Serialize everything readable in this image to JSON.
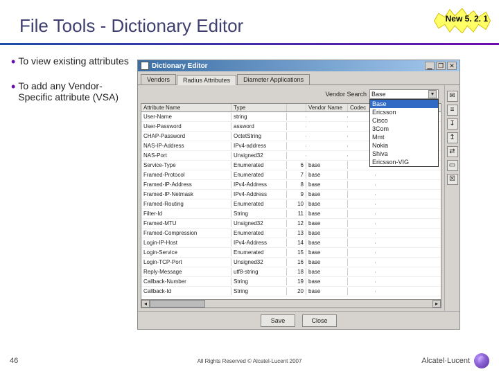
{
  "title": "File Tools - Dictionary Editor",
  "badge": "New 5. 2. 1",
  "bullets": [
    "To view existing attributes",
    "To add any Vendor-Specific attribute (VSA)"
  ],
  "window": {
    "title": "Dictionary Editor",
    "tabs": [
      "Vendors",
      "Radius Attributes",
      "Diameter Applications"
    ],
    "active_tab": 1,
    "search_label": "Vendor Search",
    "search_value": "Base",
    "dropdown_options": [
      "Base",
      "Ericsson",
      "Cisco",
      "3Com",
      "Mmt",
      "Nokia",
      "Shiva",
      "Ericsson-VIG"
    ],
    "columns": [
      "Attribute Name",
      "Type",
      "",
      "Vendor Name",
      "Codec"
    ],
    "rows": [
      {
        "name": "User-Name",
        "type": "string",
        "num": "",
        "vendor": "",
        "codec": ""
      },
      {
        "name": "User-Password",
        "type": "assword",
        "num": "",
        "vendor": "",
        "codec": ""
      },
      {
        "name": "CHAP-Password",
        "type": "OctetString",
        "num": "",
        "vendor": "",
        "codec": ""
      },
      {
        "name": "NAS-IP-Address",
        "type": "IPv4-address",
        "num": "",
        "vendor": "",
        "codec": ""
      },
      {
        "name": "NAS-Port",
        "type": "Unsigned32",
        "num": "",
        "vendor": "",
        "codec": ""
      },
      {
        "name": "Service-Type",
        "type": "Enumerated",
        "num": "6",
        "vendor": "base",
        "codec": ""
      },
      {
        "name": "Framed-Protocol",
        "type": "Enumerated",
        "num": "7",
        "vendor": "base",
        "codec": ""
      },
      {
        "name": "Framed-IP-Address",
        "type": "IPv4-Address",
        "num": "8",
        "vendor": "base",
        "codec": ""
      },
      {
        "name": "Framed-IP-Netmask",
        "type": "IPv4-Address",
        "num": "9",
        "vendor": "base",
        "codec": ""
      },
      {
        "name": "Framed-Routing",
        "type": "Enumerated",
        "num": "10",
        "vendor": "base",
        "codec": ""
      },
      {
        "name": "Filter-Id",
        "type": "String",
        "num": "11",
        "vendor": "base",
        "codec": ""
      },
      {
        "name": "Framed-MTU",
        "type": "Unsigned32",
        "num": "12",
        "vendor": "base",
        "codec": ""
      },
      {
        "name": "Framed-Compression",
        "type": "Enumerated",
        "num": "13",
        "vendor": "base",
        "codec": ""
      },
      {
        "name": "Login-IP-Host",
        "type": "IPv4-Address",
        "num": "14",
        "vendor": "base",
        "codec": ""
      },
      {
        "name": "Login-Service",
        "type": "Enumerated",
        "num": "15",
        "vendor": "base",
        "codec": ""
      },
      {
        "name": "Login-TCP-Port",
        "type": "Unsigned32",
        "num": "16",
        "vendor": "base",
        "codec": ""
      },
      {
        "name": "Reply-Message",
        "type": "utf8-string",
        "num": "18",
        "vendor": "base",
        "codec": ""
      },
      {
        "name": "Callback-Number",
        "type": "String",
        "num": "19",
        "vendor": "base",
        "codec": ""
      },
      {
        "name": "Callback-Id",
        "type": "String",
        "num": "20",
        "vendor": "base",
        "codec": ""
      }
    ],
    "buttons": {
      "save": "Save",
      "close": "Close"
    },
    "tool_icons": [
      "new-icon",
      "add-icon",
      "down-arrow-icon",
      "up-arrow-icon",
      "align-icon",
      "hide-icon",
      "delete-icon"
    ]
  },
  "footer": {
    "page": "46",
    "copyright": "All Rights Reserved © Alcatel-Lucent 2007",
    "brand": "Alcatel·Lucent"
  }
}
